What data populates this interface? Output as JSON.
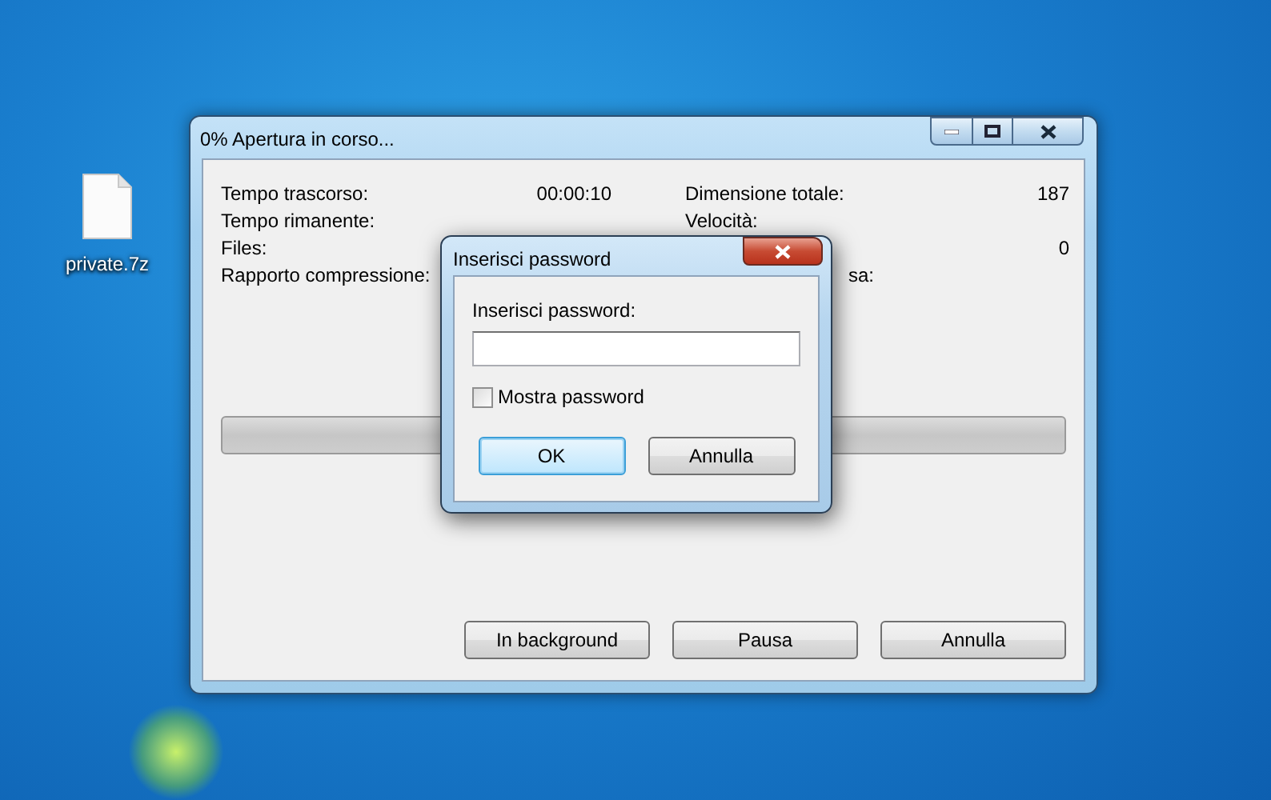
{
  "desktop": {
    "icons": [
      {
        "label": "private.7z"
      }
    ]
  },
  "window": {
    "title": "0% Apertura in corso...",
    "stats_left": [
      {
        "label": "Tempo trascorso:",
        "value": "00:00:10"
      },
      {
        "label": "Tempo rimanente:"
      },
      {
        "label": "Files:"
      },
      {
        "label": "Rapporto compressione:"
      }
    ],
    "stats_right": [
      {
        "label": "Dimensione totale:",
        "value": "187"
      },
      {
        "label": "Velocità:"
      },
      {
        "value": "0"
      },
      {
        "label": "sa:"
      }
    ],
    "progress": {
      "level": 0
    },
    "buttons": [
      "In background",
      "Pausa",
      "Annulla"
    ]
  },
  "dialog": {
    "title": "Inserisci password",
    "field_label": "Inserisci password:",
    "show_password": {
      "label": "Mostra password",
      "checked": false
    },
    "buttons": [
      {
        "label": "OK",
        "default": true
      },
      {
        "label": "Annulla",
        "default": false
      }
    ]
  }
}
